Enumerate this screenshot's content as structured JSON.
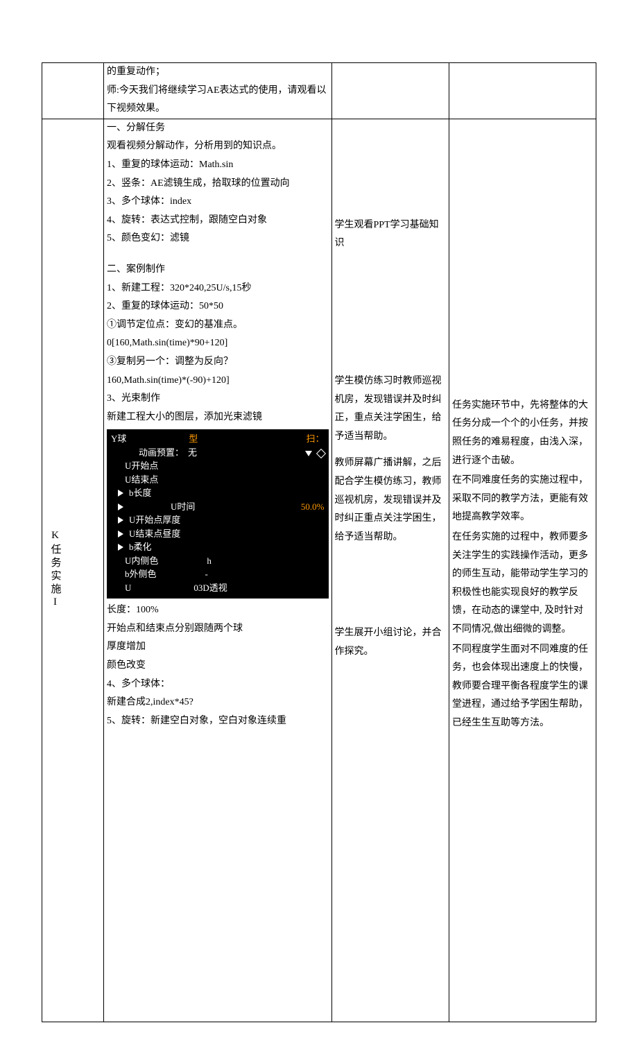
{
  "row1": {
    "col2": [
      "的重复动作；",
      "师:今天我们将继续学习AE表达式的使用，请观看以下视频效果。"
    ]
  },
  "row2": {
    "label": "K任务实施I",
    "col2_top": [
      "一、分解任务",
      "观看视频分解动作，分析用到的知识点。",
      "1、重复的球体运动：Math.sin",
      "2、竖条：AE滤镜生成，拾取球的位置动向",
      "3、多个球体：index",
      "4、旋转：表达式控制，跟随空白对象",
      "5、颜色变幻：滤镜"
    ],
    "col2_mid": [
      "二、案例制作",
      "1、新建工程：320*240,25U/s,15秒",
      "2、重复的球体运动：50*50",
      "①调节定位点：变幻的基准点。",
      "0[160,Math.sin(time)*90+120]",
      "③复制另一个：调整为反向？",
      "160,Math.sin(time)*(-90)+120]",
      "3、光束制作",
      "新建工程大小的图层，添加光束滤镜"
    ],
    "blackbox": {
      "header_left": "Y球",
      "header_mid": "型",
      "header_right": "扫：",
      "preset_label": "动画预置：",
      "preset_value": "无",
      "lines": [
        "U开始点",
        "U结束点"
      ],
      "tri_lines": [
        {
          "label": "b长度",
          "value": ""
        },
        {
          "label": "U时间",
          "value": "50.0%"
        },
        {
          "label": "U开始点厚度",
          "value": ""
        },
        {
          "label": "U结束点昼度",
          "value": ""
        },
        {
          "label": "b柔化",
          "value": ""
        }
      ],
      "plain_lines": [
        {
          "l": "U内侧色",
          "r": "h"
        },
        {
          "l": "b外侧色",
          "r": "-"
        },
        {
          "l": "U",
          "r": "03D透视"
        }
      ]
    },
    "col2_after": [
      "长度：100%",
      "开始点和结束点分别跟随两个球",
      "厚度增加",
      "颜色改变",
      "4、多个球体：",
      "新建合成2,index*45?",
      "5、旋转：新建空白对象，空白对象连续重"
    ],
    "col3_blocks": [
      "学生观看PPT学习基础知识",
      "学生模仿练习时教师巡视机房，发现错误并及时纠正，重点关注学困生，给予适当帮助。",
      "教师屏幕广播讲解，之后配合学生模仿练习，教师巡视机房，发现错误并及时纠正重点关注学困生，给予适当帮助。",
      "学生展开小组讨论，并合作探究。"
    ],
    "col4": [
      "任务实施环节中，先将整体的大任务分成一个个的小任务，并按照任务的难易程度，由浅入深，进行逐个击破。",
      "在不同难度任务的实施过程中，采取不同的教学方法，更能有效地提高教学效率。",
      "在任务实施的过程中，教师要多关注学生的实践操作活动，更多的师生互动，能带动学生学习的积极性也能实现良好的教学反馈，在动态的课堂中, 及时针对不同情况,做出细微的调整。",
      "不同程度学生面对不同难度的任务，也会体现出速度上的快慢，教师要合理平衡各程度学生的课堂进程，通过给予学困生帮助，已经生生互助等方法。"
    ]
  }
}
